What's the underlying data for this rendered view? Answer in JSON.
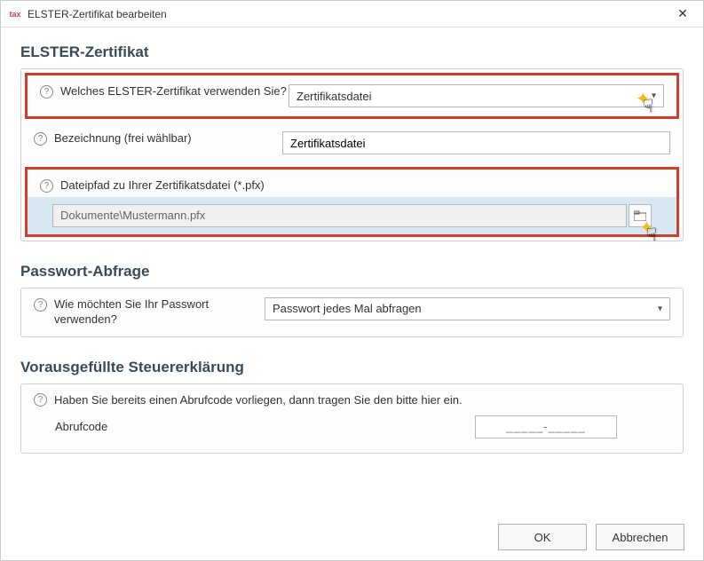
{
  "window": {
    "title": "ELSTER-Zertifikat bearbeiten",
    "app_icon_text": "tax"
  },
  "section1": {
    "heading": "ELSTER-Zertifikat",
    "cert_question": "Welches ELSTER-Zertifikat verwenden Sie?",
    "cert_value": "Zertifikatsdatei",
    "bezeichnung_label": "Bezeichnung (frei wählbar)",
    "bezeichnung_value": "Zertifikatsdatei",
    "path_label": "Dateipfad zu Ihrer Zertifikatsdatei (*.pfx)",
    "path_value": "Dokumente\\Mustermann.pfx"
  },
  "section2": {
    "heading": "Passwort-Abfrage",
    "question": "Wie möchten Sie Ihr Passwort verwenden?",
    "value": "Passwort jedes Mal abfragen"
  },
  "section3": {
    "heading": "Vorausgefüllte Steuererklärung",
    "question": "Haben Sie bereits einen Abrufcode vorliegen, dann tragen Sie den bitte hier ein.",
    "code_label": "Abrufcode",
    "code_placeholder": "_____-_____"
  },
  "footer": {
    "ok": "OK",
    "cancel": "Abbrechen"
  }
}
